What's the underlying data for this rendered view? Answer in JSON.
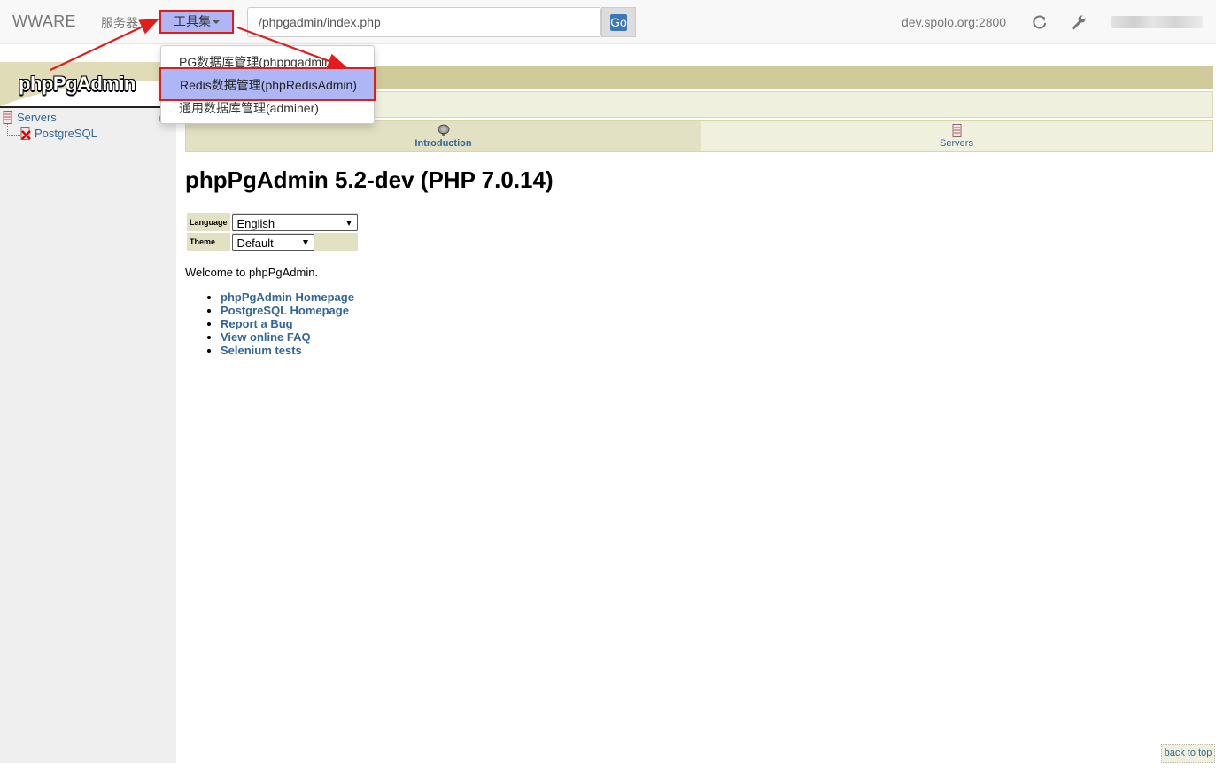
{
  "navbar": {
    "brand": "WWARE",
    "servers_menu": "服务器",
    "tools_menu": "工具集",
    "url_value": "/phpgadmin/index.php",
    "go_label": "Go",
    "host": "dev.spolo.org:2800",
    "refresh_icon": "refresh-icon",
    "settings_icon": "wrench-icon"
  },
  "dropdown": {
    "items": [
      {
        "label": "PG数据库管理(phppgadmin)"
      },
      {
        "label": "Redis数据管理(phpRedisAdmin)"
      },
      {
        "label": "通用数据库管理(adminer)"
      }
    ]
  },
  "sidebar": {
    "logo": "phpPgAdmin",
    "tree": {
      "root": "Servers",
      "child": "PostgreSQL"
    }
  },
  "tabs": [
    {
      "label": "Introduction",
      "icon": "elephant-icon",
      "active": true
    },
    {
      "label": "Servers",
      "icon": "servers-icon",
      "active": false
    }
  ],
  "main": {
    "title": "phpPgAdmin 5.2-dev (PHP 7.0.14)",
    "prefs": {
      "language_label": "Language",
      "language_value": "English",
      "theme_label": "Theme",
      "theme_value": "Default"
    },
    "welcome": "Welcome to phpPgAdmin.",
    "links": [
      "phpPgAdmin Homepage",
      "PostgreSQL Homepage",
      "Report a Bug",
      "View online FAQ",
      "Selenium tests"
    ],
    "back_to_top": "back to top"
  },
  "colors": {
    "highlight": "#aeb6f5",
    "annotation_red": "#e41b1b",
    "link": "#336699",
    "khaki": "#cfcb9a"
  }
}
